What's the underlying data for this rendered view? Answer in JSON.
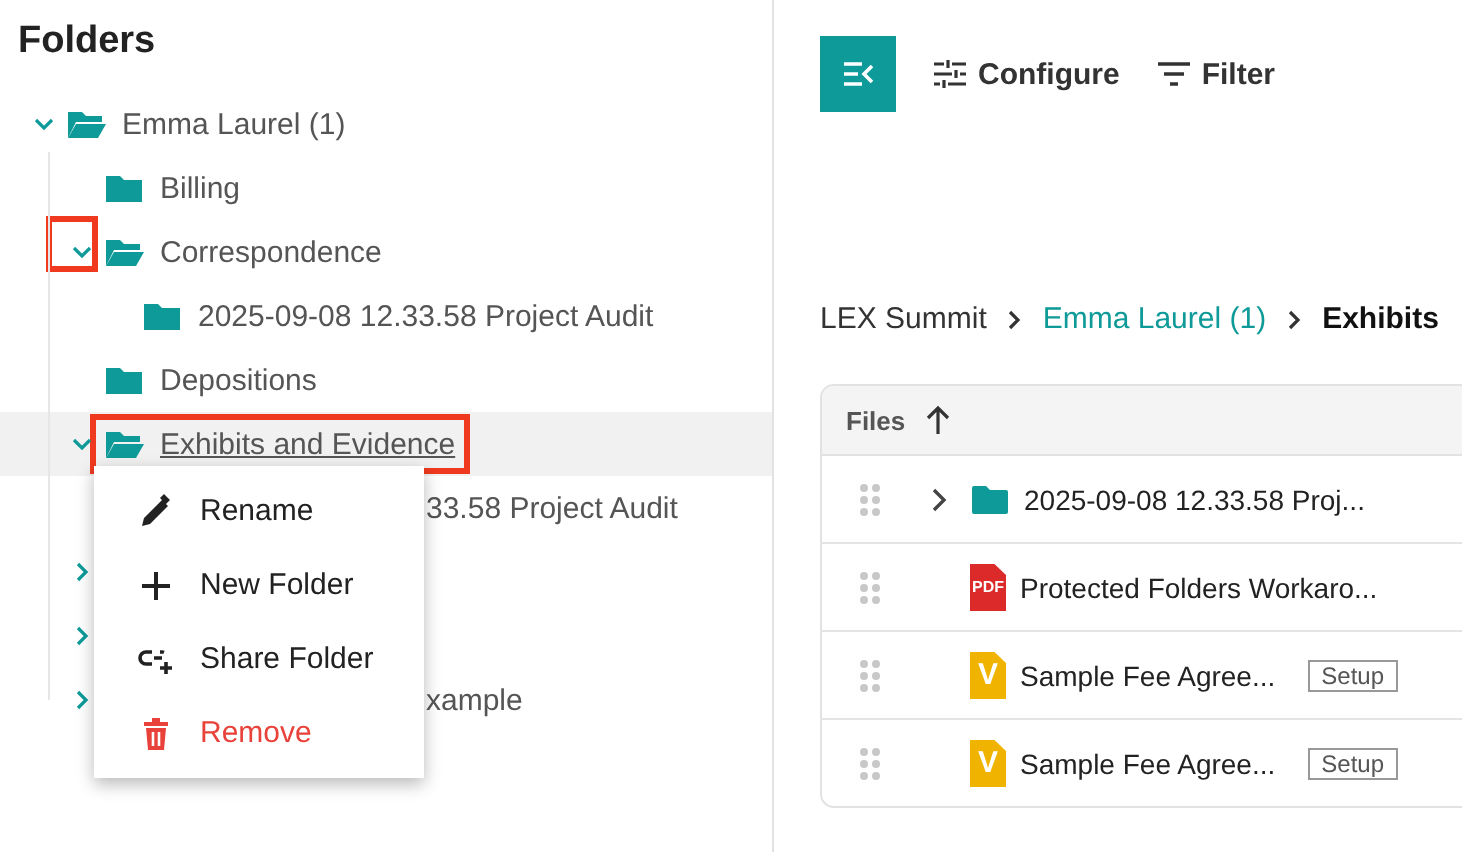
{
  "sidebar": {
    "title": "Folders",
    "tree": [
      {
        "label": "Emma Laurel (1)",
        "kind": "branch",
        "expanded": true,
        "selected": false,
        "children": [
          {
            "label": "Billing",
            "kind": "leaf",
            "selected": false
          },
          {
            "label": "Correspondence",
            "kind": "branch",
            "expanded": true,
            "selected": false,
            "chevron_highlighted": true,
            "children": [
              {
                "label": "2025-09-08 12.33.58 Project Audit",
                "kind": "leaf",
                "selected": false
              }
            ]
          },
          {
            "label": "Depositions",
            "kind": "leaf",
            "selected": false
          },
          {
            "label": "Exhibits and Evidence",
            "kind": "branch",
            "expanded": true,
            "selected": true,
            "highlighted": true,
            "children": [
              {
                "label": "33.58 Project Audit",
                "kind": "leaf",
                "selected": false,
                "covered": true
              }
            ]
          },
          {
            "kind": "branch",
            "expanded": false,
            "selected": false,
            "covered": true
          },
          {
            "kind": "branch",
            "expanded": false,
            "selected": false,
            "covered": true
          },
          {
            "label": "xample",
            "kind": "branch",
            "expanded": false,
            "selected": false,
            "covered": true
          }
        ]
      }
    ]
  },
  "context_menu": [
    {
      "label": "Rename",
      "kind": "rename"
    },
    {
      "label": "New Folder",
      "kind": "add"
    },
    {
      "label": "Share Folder",
      "kind": "share"
    },
    {
      "label": "Remove",
      "kind": "danger"
    }
  ],
  "toolbar": {
    "buttons": [
      "Configure",
      "Filter"
    ]
  },
  "breadcrumb": [
    {
      "label": "LEX Summit",
      "kind": "plain"
    },
    {
      "label": "Emma Laurel (1)",
      "kind": "link"
    },
    {
      "label": "Exhibits",
      "kind": "current"
    }
  ],
  "table": {
    "column": "Files",
    "sort_ascending": true,
    "rows": [
      {
        "name": "2025-09-08 12.33.58 Proj...",
        "kind": "folder",
        "expandable": true
      },
      {
        "name": "Protected Folders Workaro...",
        "kind": "pdf",
        "icon_text": "PDF",
        "expandable": false
      },
      {
        "name": "Sample Fee Agree...",
        "kind": "template",
        "icon_text": "V",
        "tag": "Setup",
        "expandable": false
      },
      {
        "name": "Sample Fee Agree...",
        "kind": "template",
        "icon_text": "V",
        "tag": "Setup",
        "expandable": false
      }
    ]
  }
}
